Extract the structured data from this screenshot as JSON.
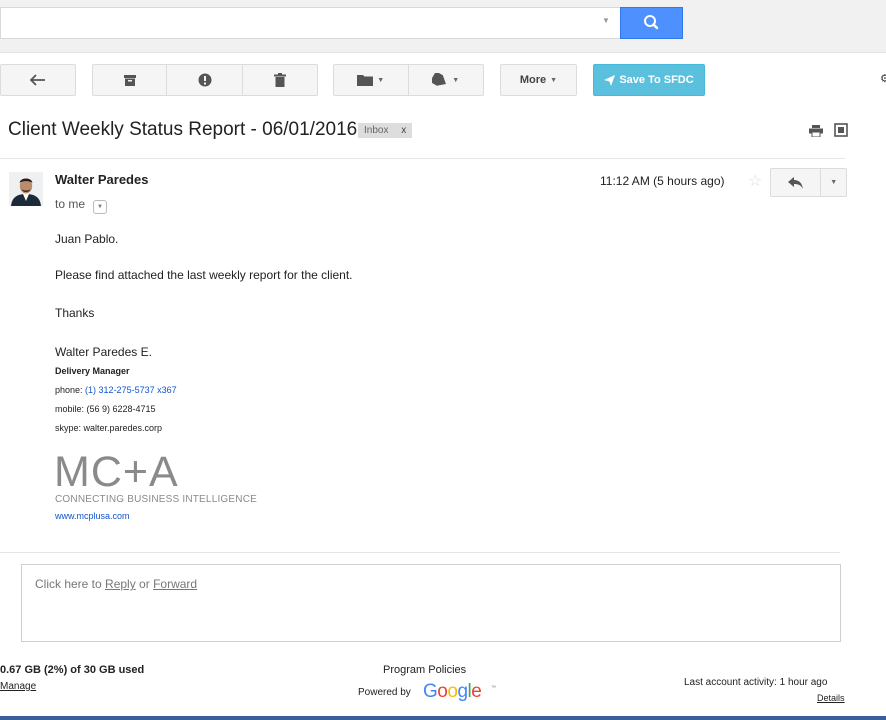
{
  "search": {
    "value": "",
    "placeholder": ""
  },
  "toolbar": {
    "more_label": "More",
    "sfdc_label": "Save To SFDC"
  },
  "message": {
    "subject": "Client Weekly Status Report - 06/01/2016",
    "label": "Inbox",
    "label_remove": "x",
    "sender": "Walter Paredes",
    "recipient_line": "to me",
    "timestamp": "11:12 AM (5 hours ago)"
  },
  "body": {
    "greeting": "Juan Pablo.",
    "paragraph": "Please find attached the last weekly report for the client.",
    "closing": "Thanks",
    "signature": {
      "name": "Walter Paredes E.",
      "title": "Delivery Manager",
      "phone_label": "phone:",
      "phone_value": "(1) 312-275-5737  x367",
      "mobile": "mobile: (56 9) 6228-4715",
      "skype": "skype: walter.paredes.corp",
      "logo_mark": "MC+A",
      "logo_tagline": "CONNECTING BUSINESS INTELLIGENCE",
      "logo_url": "www.mcplusa.com"
    }
  },
  "reply_box": {
    "prefix": "Click here to ",
    "reply": "Reply",
    "middle": " or ",
    "forward": "Forward"
  },
  "footer": {
    "storage": "0.67 GB (2%) of 30 GB used",
    "manage": "Manage",
    "program_policies": "Program Policies",
    "powered_by": "Powered by",
    "google": "Google",
    "last_activity": "Last account activity: 1 hour ago",
    "details": "Details"
  },
  "icons": {
    "search": "search-icon",
    "back": "arrow-left-icon",
    "archive": "archive-icon",
    "spam": "report-spam-icon",
    "delete": "trash-icon",
    "move": "folder-icon",
    "labels": "label-tag-icon",
    "print": "print-icon",
    "new_window": "new-window-icon",
    "star": "star-icon",
    "reply": "reply-icon",
    "more_actions": "chevron-down-icon"
  },
  "colors": {
    "search_button": "#4d90fe",
    "sfdc_button": "#5bc0de",
    "link": "#1155cc"
  }
}
